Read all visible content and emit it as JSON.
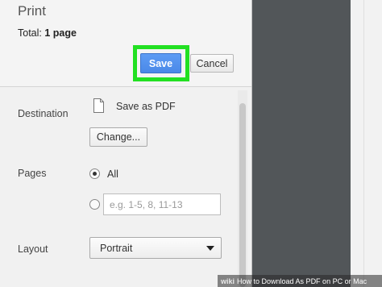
{
  "header": {
    "title": "Print",
    "total_prefix": "Total: ",
    "total_count": "1 page"
  },
  "actions": {
    "save_label": "Save",
    "cancel_label": "Cancel"
  },
  "destination": {
    "label": "Destination",
    "value": "Save as PDF",
    "icon": "pdf-file-icon",
    "change_label": "Change..."
  },
  "pages": {
    "label": "Pages",
    "options": {
      "all_label": "All",
      "all_selected": true,
      "custom_selected": false
    },
    "custom_placeholder": "e.g. 1-5, 8, 11-13",
    "custom_value": ""
  },
  "layout": {
    "label": "Layout",
    "selected": "Portrait"
  },
  "caption": {
    "brand": "wiki",
    "text": "How to Download As PDF on PC or Mac"
  },
  "colors": {
    "highlight": "#22e022",
    "save_button": "#4a88e8",
    "preview_background": "#525659"
  }
}
